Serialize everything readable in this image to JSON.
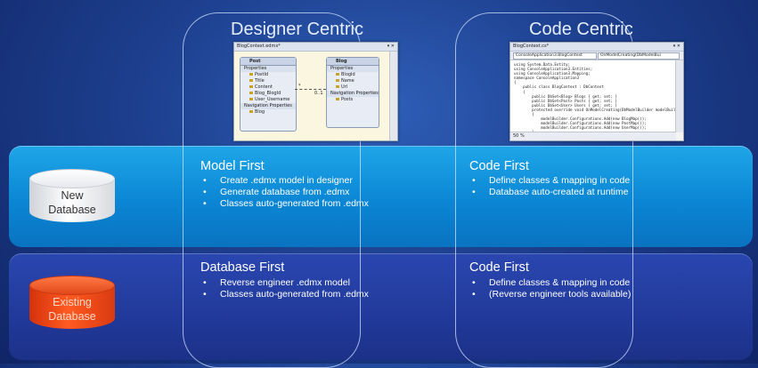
{
  "columns": {
    "designer_title": "Designer Centric",
    "code_title": "Code Centric"
  },
  "rows": {
    "new_db_label_1": "New",
    "new_db_label_2": "Database",
    "existing_db_label_1": "Existing",
    "existing_db_label_2": "Database"
  },
  "model_first": {
    "title": "Model First",
    "items": [
      "Create .edmx model in designer",
      "Generate database from .edmx",
      "Classes auto-generated from .edmx"
    ]
  },
  "code_first_new": {
    "title": "Code First",
    "items": [
      "Define classes & mapping in code",
      "Database auto-created at runtime"
    ]
  },
  "database_first": {
    "title": "Database First",
    "items": [
      "Reverse engineer .edmx model",
      "Classes auto-generated from .edmx"
    ]
  },
  "code_first_existing": {
    "title": "Code First",
    "items": [
      "Define classes & mapping in code",
      "(Reverse engineer tools available)"
    ]
  },
  "designer_window": {
    "tab": "BlogContext.edmx*",
    "post": {
      "title": "Post",
      "properties_label": "Properties",
      "props": [
        "PostId",
        "Title",
        "Content",
        "Blog_BlogId",
        "User_Username"
      ],
      "nav_label": "Navigation Properties",
      "nav": [
        "Blog"
      ]
    },
    "blog": {
      "title": "Blog",
      "properties_label": "Properties",
      "props": [
        "BlogId",
        "Name",
        "Url"
      ],
      "nav_label": "Navigation Properties",
      "nav": [
        "Posts"
      ]
    },
    "mult_many": "*",
    "mult_one": "0..1"
  },
  "code_window": {
    "tab": "BlogContext.cs*",
    "drop1": "ConsoleApplication3.BlogContext",
    "drop2": "OnModelCreating(DbModelBui",
    "zoom": "50 %",
    "lines": [
      "using System.Data.Entity;",
      "using ConsoleApplication3.Entities;",
      "using ConsoleApplication3.Mapping;",
      "",
      "namespace ConsoleApplication3",
      "{",
      "    public class BlogContext : DbContext",
      "    {",
      "        public DbSet<Blog> Blogs { get; set; }",
      "        public DbSet<Post> Posts { get; set; }",
      "        public DbSet<User> Users { get; set; }",
      "",
      "        protected override void OnModelCreating(DbModelBuilder modelBuil",
      "        {",
      "            modelBuilder.Configurations.Add(new BlogMap());",
      "            modelBuilder.Configurations.Add(new PostMap());",
      "            modelBuilder.Configurations.Add(new UserMap());",
      "        }"
    ]
  }
}
